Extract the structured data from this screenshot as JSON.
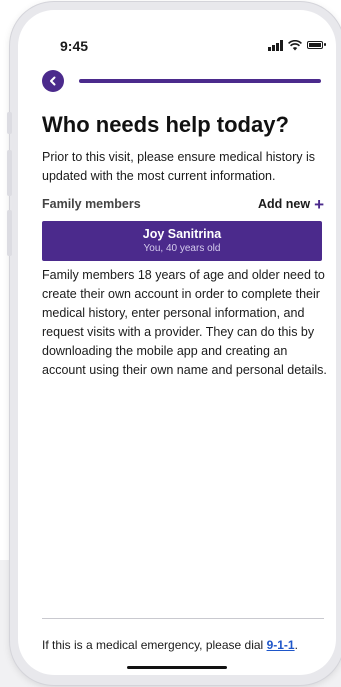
{
  "status_bar": {
    "time": "9:45"
  },
  "icons": {
    "back": "chevron-left-icon",
    "signal": "signal-bars-icon",
    "wifi": "wifi-icon",
    "battery": "battery-icon",
    "plus": "plus-icon"
  },
  "colors": {
    "brand_purple": "#4b2a8c",
    "link_blue": "#1e56c9"
  },
  "main": {
    "title": "Who needs help today?",
    "intro": "Prior to this visit, please ensure medical history is updated with the most current information.",
    "family_label": "Family members",
    "add_new_label": "Add new",
    "plus_glyph": "+",
    "members": [
      {
        "name": "Joy Sanitrina",
        "subtitle": "You, 40 years old"
      }
    ],
    "info": "Family members 18 years of age and older need to create their own account in order to complete their medical history, enter personal information, and request visits with a provider. They can do this by downloading the mobile app and creating an account using their own name and personal details."
  },
  "footer": {
    "emergency_prefix": "If this is a medical emergency, please dial ",
    "emergency_number": "9-1-1",
    "emergency_suffix": "."
  }
}
